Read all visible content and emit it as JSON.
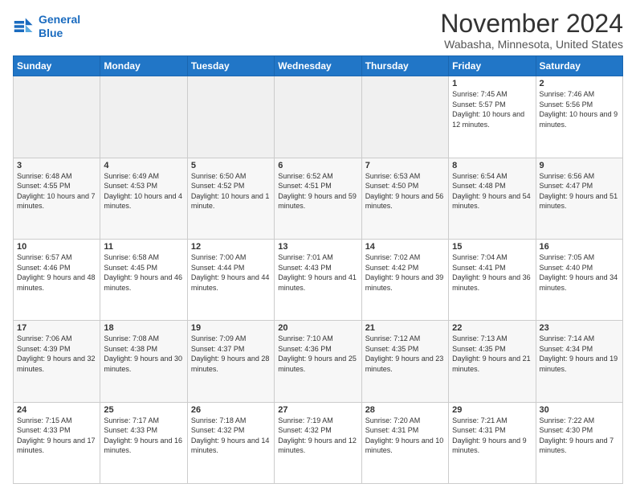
{
  "logo": {
    "line1": "General",
    "line2": "Blue"
  },
  "title": "November 2024",
  "subtitle": "Wabasha, Minnesota, United States",
  "days_header": [
    "Sunday",
    "Monday",
    "Tuesday",
    "Wednesday",
    "Thursday",
    "Friday",
    "Saturday"
  ],
  "weeks": [
    [
      {
        "day": "",
        "info": ""
      },
      {
        "day": "",
        "info": ""
      },
      {
        "day": "",
        "info": ""
      },
      {
        "day": "",
        "info": ""
      },
      {
        "day": "",
        "info": ""
      },
      {
        "day": "1",
        "info": "Sunrise: 7:45 AM\nSunset: 5:57 PM\nDaylight: 10 hours and 12 minutes."
      },
      {
        "day": "2",
        "info": "Sunrise: 7:46 AM\nSunset: 5:56 PM\nDaylight: 10 hours and 9 minutes."
      }
    ],
    [
      {
        "day": "3",
        "info": "Sunrise: 6:48 AM\nSunset: 4:55 PM\nDaylight: 10 hours and 7 minutes."
      },
      {
        "day": "4",
        "info": "Sunrise: 6:49 AM\nSunset: 4:53 PM\nDaylight: 10 hours and 4 minutes."
      },
      {
        "day": "5",
        "info": "Sunrise: 6:50 AM\nSunset: 4:52 PM\nDaylight: 10 hours and 1 minute."
      },
      {
        "day": "6",
        "info": "Sunrise: 6:52 AM\nSunset: 4:51 PM\nDaylight: 9 hours and 59 minutes."
      },
      {
        "day": "7",
        "info": "Sunrise: 6:53 AM\nSunset: 4:50 PM\nDaylight: 9 hours and 56 minutes."
      },
      {
        "day": "8",
        "info": "Sunrise: 6:54 AM\nSunset: 4:48 PM\nDaylight: 9 hours and 54 minutes."
      },
      {
        "day": "9",
        "info": "Sunrise: 6:56 AM\nSunset: 4:47 PM\nDaylight: 9 hours and 51 minutes."
      }
    ],
    [
      {
        "day": "10",
        "info": "Sunrise: 6:57 AM\nSunset: 4:46 PM\nDaylight: 9 hours and 48 minutes."
      },
      {
        "day": "11",
        "info": "Sunrise: 6:58 AM\nSunset: 4:45 PM\nDaylight: 9 hours and 46 minutes."
      },
      {
        "day": "12",
        "info": "Sunrise: 7:00 AM\nSunset: 4:44 PM\nDaylight: 9 hours and 44 minutes."
      },
      {
        "day": "13",
        "info": "Sunrise: 7:01 AM\nSunset: 4:43 PM\nDaylight: 9 hours and 41 minutes."
      },
      {
        "day": "14",
        "info": "Sunrise: 7:02 AM\nSunset: 4:42 PM\nDaylight: 9 hours and 39 minutes."
      },
      {
        "day": "15",
        "info": "Sunrise: 7:04 AM\nSunset: 4:41 PM\nDaylight: 9 hours and 36 minutes."
      },
      {
        "day": "16",
        "info": "Sunrise: 7:05 AM\nSunset: 4:40 PM\nDaylight: 9 hours and 34 minutes."
      }
    ],
    [
      {
        "day": "17",
        "info": "Sunrise: 7:06 AM\nSunset: 4:39 PM\nDaylight: 9 hours and 32 minutes."
      },
      {
        "day": "18",
        "info": "Sunrise: 7:08 AM\nSunset: 4:38 PM\nDaylight: 9 hours and 30 minutes."
      },
      {
        "day": "19",
        "info": "Sunrise: 7:09 AM\nSunset: 4:37 PM\nDaylight: 9 hours and 28 minutes."
      },
      {
        "day": "20",
        "info": "Sunrise: 7:10 AM\nSunset: 4:36 PM\nDaylight: 9 hours and 25 minutes."
      },
      {
        "day": "21",
        "info": "Sunrise: 7:12 AM\nSunset: 4:35 PM\nDaylight: 9 hours and 23 minutes."
      },
      {
        "day": "22",
        "info": "Sunrise: 7:13 AM\nSunset: 4:35 PM\nDaylight: 9 hours and 21 minutes."
      },
      {
        "day": "23",
        "info": "Sunrise: 7:14 AM\nSunset: 4:34 PM\nDaylight: 9 hours and 19 minutes."
      }
    ],
    [
      {
        "day": "24",
        "info": "Sunrise: 7:15 AM\nSunset: 4:33 PM\nDaylight: 9 hours and 17 minutes."
      },
      {
        "day": "25",
        "info": "Sunrise: 7:17 AM\nSunset: 4:33 PM\nDaylight: 9 hours and 16 minutes."
      },
      {
        "day": "26",
        "info": "Sunrise: 7:18 AM\nSunset: 4:32 PM\nDaylight: 9 hours and 14 minutes."
      },
      {
        "day": "27",
        "info": "Sunrise: 7:19 AM\nSunset: 4:32 PM\nDaylight: 9 hours and 12 minutes."
      },
      {
        "day": "28",
        "info": "Sunrise: 7:20 AM\nSunset: 4:31 PM\nDaylight: 9 hours and 10 minutes."
      },
      {
        "day": "29",
        "info": "Sunrise: 7:21 AM\nSunset: 4:31 PM\nDaylight: 9 hours and 9 minutes."
      },
      {
        "day": "30",
        "info": "Sunrise: 7:22 AM\nSunset: 4:30 PM\nDaylight: 9 hours and 7 minutes."
      }
    ]
  ]
}
